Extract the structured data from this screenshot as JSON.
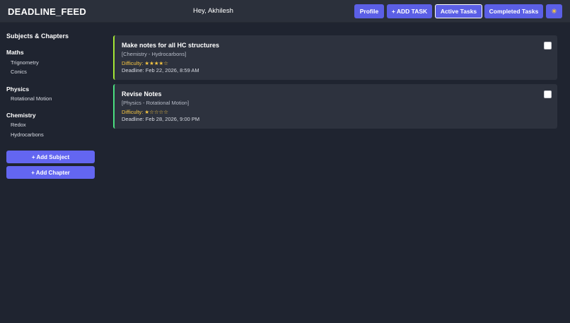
{
  "header": {
    "brand": "DEADLINE_FEED",
    "greeting": "Hey, Akhilesh",
    "profile_label": "Profile",
    "add_task_label": "+ ADD TASK",
    "active_tasks_label": "Active Tasks",
    "completed_tasks_label": "Completed Tasks",
    "theme_icon": "sun-icon",
    "theme_glyph": "☀"
  },
  "sidebar": {
    "title": "Subjects & Chapters",
    "subjects": [
      {
        "name": "Maths",
        "chapters": [
          "Trignometry",
          "Conics"
        ]
      },
      {
        "name": "Physics",
        "chapters": [
          "Rotational Motion"
        ]
      },
      {
        "name": "Chemistry",
        "chapters": [
          "Redox",
          "Hydrocarbons"
        ]
      }
    ],
    "add_subject_label": "+ Add Subject",
    "add_chapter_label": "+ Add Chapter"
  },
  "tasks": [
    {
      "title": "Make notes for all HC structures",
      "subtitle": "[Chemistry - Hydrocarbons]",
      "difficulty": "Difficulty: ★★★★☆",
      "deadline": "Deadline: Feb 22, 2026, 8:59 AM",
      "accent": "#a3e635"
    },
    {
      "title": "Revise Notes",
      "subtitle": "[Physics - Rotational Motion]",
      "difficulty": "Difficulty: ★☆☆☆☆",
      "deadline": "Deadline: Feb 28, 2026, 9:00 PM",
      "accent": "#4ade80"
    }
  ],
  "colors": {
    "background": "#1f2430",
    "topbar": "#2b303b",
    "primary": "#5b5fe6",
    "card": "#2d323e",
    "star": "#f5c542"
  }
}
